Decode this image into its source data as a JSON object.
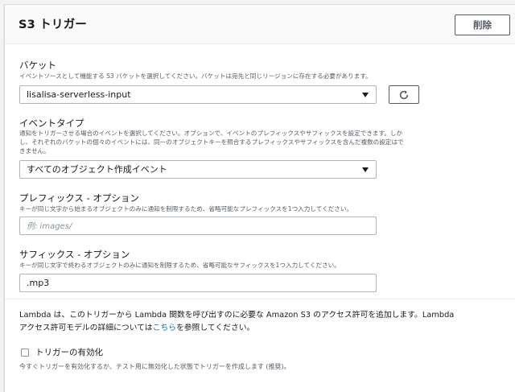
{
  "header": {
    "title": "S3 トリガー",
    "delete_label": "削除"
  },
  "bucket": {
    "label": "バケット",
    "description": "イベントソースとして機能する S3 バケットを選択してください。バケットは宛先と同じリージョンに存在する必要があります。",
    "selected": "lisalisa-serverless-input",
    "refresh_icon": "refresh-icon"
  },
  "event_type": {
    "label": "イベントタイプ",
    "description_line1": "通知をトリガーさせる場合のイベントを選択してください。オプションで、イベントのプレフィックスやサフィックスを設定できます。しか",
    "description_line2": "し、それぞれのバケットの個々のイベントには、同一のオブジェクトキーを照合するプレフィックスやサフィックスを含んだ複数の設定はで",
    "description_line3": "きません。",
    "selected": "すべてのオブジェクト作成イベント"
  },
  "prefix": {
    "label": "プレフィックス - オプション",
    "description": "キーが同じ文字から始まるオブジェクトのみに通知を制限するため、省略可能なプレフィックスを1つ入力してください。",
    "value": "",
    "placeholder": "例: images/"
  },
  "suffix": {
    "label": "サフィックス - オプション",
    "description": "キーが同じ文字で終わるオブジェクトのみに通知を制限するため、省略可能なサフィックスを1つ入力してください。",
    "value": ".mp3"
  },
  "note": {
    "part1": "Lambda は、このトリガーから Lambda 関数を呼び出すのに必要な Amazon S3 のアクセス許可を追加します。Lambda",
    "part2": "アクセス許可モデルの詳細については",
    "link": "こちら",
    "part3": "を参照してください。"
  },
  "enable_trigger": {
    "label": "トリガーの有効化",
    "checked": false,
    "description": "今すぐトリガーを有効化するか、テスト用に無効化した状態でトリガーを作成します (推奨)。"
  },
  "colors": {
    "link": "#0073bb",
    "border": "#aab7b8",
    "text": "#16191f",
    "muted": "#545b64"
  }
}
